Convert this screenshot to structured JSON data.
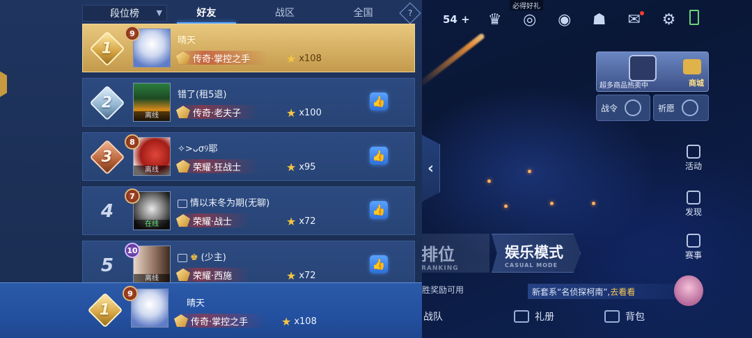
{
  "leaderboard": {
    "tab_select": "段位榜",
    "tabs": [
      "好友",
      "战区",
      "全国"
    ],
    "rows": [
      {
        "rank": "1",
        "level": "9",
        "name": "晴天",
        "tier": "传奇·掌控之手",
        "stars": "x108",
        "presence": ""
      },
      {
        "rank": "2",
        "level": "",
        "name": "错了(租5退)",
        "tier": "传奇·老夫子",
        "stars": "x100",
        "presence": "离线"
      },
      {
        "rank": "3",
        "level": "8",
        "name": "✧>ᴗσ୨耶",
        "tier": "荣耀·狂战士",
        "stars": "x95",
        "presence": "离线"
      },
      {
        "rank": "4",
        "level": "7",
        "name": "情以末冬为期(无聊)",
        "tier": "荣耀·战士",
        "stars": "x72",
        "presence": "在线"
      },
      {
        "rank": "5",
        "level": "10",
        "name": "(少主)",
        "tier": "荣耀·西施",
        "stars": "x72",
        "presence": "离线"
      }
    ],
    "me": {
      "rank": "1",
      "level": "9",
      "name": "晴天",
      "tier": "传奇·掌控之手",
      "stars": "x108"
    }
  },
  "game": {
    "coin_count": "54",
    "mini_label": "必得好礼",
    "shop_promo": "超多商品热卖中",
    "shop_label": "商城",
    "battle_pass": "战令",
    "wish": "祈愿",
    "side": [
      "活动",
      "发现",
      "赛事"
    ],
    "mode_rank": "排位",
    "mode_rank_sub": "RANKING",
    "mode_fun": "娱乐模式",
    "mode_fun_sub": "CASUAL MODE",
    "reward_note": "胜奖励可用",
    "news_prefix": "新套系“名侦探柯南”,",
    "news_link": "去看看",
    "bottom_nav": [
      "战队",
      "礼册",
      "背包"
    ]
  },
  "colors": {
    "accent": "#59a8ff",
    "gold": "#d4a443",
    "panel": "#1f3560"
  }
}
